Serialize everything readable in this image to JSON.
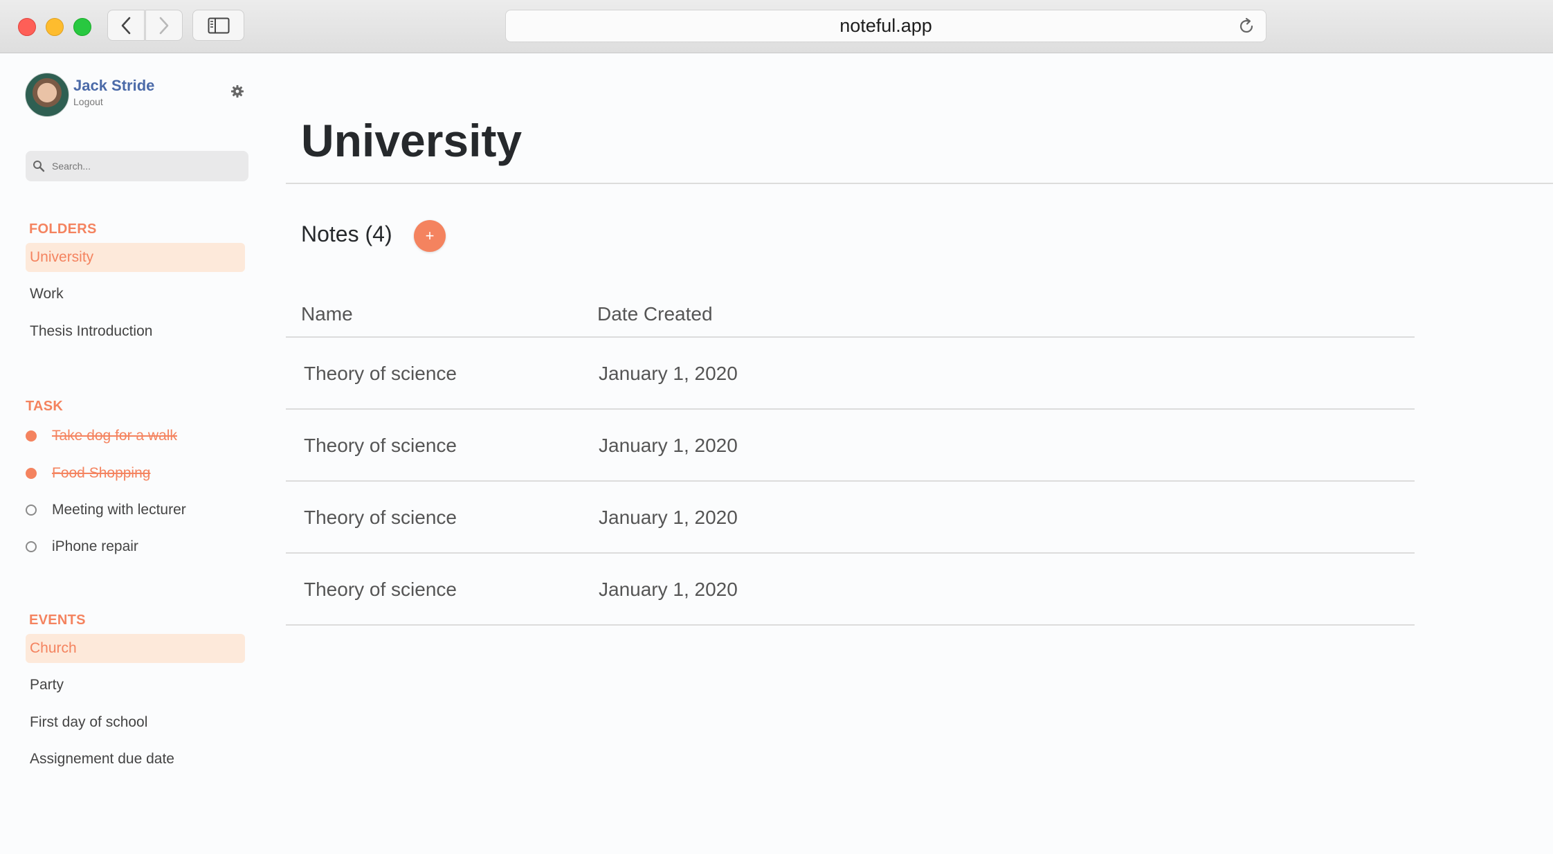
{
  "browser": {
    "url": "noteful.app"
  },
  "user": {
    "name": "Jack Stride",
    "logout_label": "Logout"
  },
  "search": {
    "placeholder": "Search..."
  },
  "folders": {
    "title": "FOLDERS",
    "items": [
      {
        "label": "University",
        "active": true
      },
      {
        "label": "Work",
        "active": false
      },
      {
        "label": "Thesis Introduction",
        "active": false
      }
    ]
  },
  "tasks": {
    "title": "TASK",
    "items": [
      {
        "label": "Take dog for a walk",
        "done": true
      },
      {
        "label": "Food Shopping",
        "done": true
      },
      {
        "label": "Meeting with lecturer",
        "done": false
      },
      {
        "label": "iPhone repair",
        "done": false
      }
    ]
  },
  "events": {
    "title": "EVENTS",
    "items": [
      {
        "label": "Church",
        "active": true
      },
      {
        "label": "Party",
        "active": false
      },
      {
        "label": "First day of school",
        "active": false
      },
      {
        "label": "Assignement due date",
        "active": false
      }
    ]
  },
  "main": {
    "title": "University",
    "notes_heading": "Notes (4)",
    "add_label": "+",
    "columns": [
      "Name",
      "Date Created"
    ],
    "rows": [
      {
        "name": "Theory of science",
        "date": "January 1, 2020"
      },
      {
        "name": "Theory of science",
        "date": "January 1, 2020"
      },
      {
        "name": "Theory of science",
        "date": "January 1, 2020"
      },
      {
        "name": "Theory of science",
        "date": "January 1, 2020"
      }
    ]
  },
  "colors": {
    "accent": "#f4835f",
    "accent_bg": "#fde9da",
    "username": "#4b6aa8"
  }
}
